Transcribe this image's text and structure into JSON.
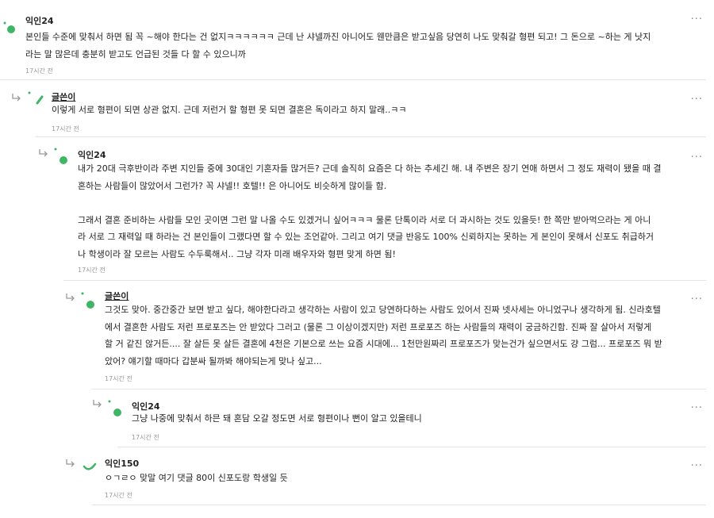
{
  "comments": [
    {
      "author": "익인24",
      "text": "본인들 수준에 맞춰서 하면 됨 꼭 ~해야 한다는 건 없지ㅋㅋㅋㅋㅋㅋ 근데 난 샤넬까진 아니어도 웬만큼은 받고싶음 당연히 나도 맞춰갈 형편 되고! 그 돈으로 ~하는 게 낫지\n라는 말 많은데 충분히 받고도 언급된 것들 다 할 수 있으니까",
      "time": "17시간 전"
    },
    {
      "author": "글쓴이",
      "text": "이렇게 서로 형편이 되면 상관 없지. 근데 저런거 할 형편 못 되면 결혼은 독이라고 하지 말래..ㅋㅋ",
      "time": "17시간 전"
    },
    {
      "author": "익인24",
      "text": "내가 20대 극후반이라 주변 지인들 중에 30대인 기혼자들 많거든? 근데 솔직히 요즘은 다 하는 추세긴 해. 내 주변은 장기 연애 하면서 그 정도 재력이 됐을 때 결\n혼하는 사람들이 많았어서 그런가? 꼭 샤넬!! 호텔!! 은 아니어도 비슷하게 많이들 함.\n\n그래서 결혼 준비하는 사람들 모인 곳이면 그런 말 나올 수도 있겠거니 싶어ㅋㅋㅋ 물론 단톡이라 서로 더 과시하는 것도 있을듯! 한 쪽만 받아먹으라는 게 아니\n라 서로 그 재력일 때 하라는 건 본인들이 그랬다면 할 수 있는 조언같아. 그리고 여기 댓글 반응도 100% 신뢰하지는 못하는 게 본인이 못해서 신포도 취급하거\n나 학생이라 잘 모르는 사람도 수두룩해서.. 그냥 각자 미래 배우자와 형편 맞게 하면 됨!",
      "time": "17시간 전"
    },
    {
      "author": "글쓴이",
      "text": "그것도 맞아. 중간중간 보면 받고 싶다, 해야한다라고 생각하는 사람이 있고 당연하다하는 사람도 있어서 진짜 넷사세는 아니었구나 생각하게 됨. 신라호텔\n에서 결혼한 사람도 저런 프로포즈는 안 받았다 그러고 (물론 그 이상이겠지만) 저런 프로포즈 하는 사람들의 재력이 궁금하긴함. 진짜 잘 살아서 저렇게\n할 거 같진 않거든.... 잘 살든 못 살든 결혼에 4천은 기본으로 쓰는 요즘 시대에... 1천만원짜리 프로포즈가 맞는건가 싶으면서도 걍 그럼... 프로포즈 뭐 받\n았어? 얘기할 때마다 갑분싸 될까봐 해야되는게 맞나 싶고...",
      "time": "17시간 전"
    },
    {
      "author": "익인24",
      "text": "그냥 나중에 맞춰서 하믄 돼 혼담 오갈 정도면 서로 형편이나 뻔이 알고 있을테니",
      "time": "17시간 전"
    },
    {
      "author": "익인150",
      "text": "ㅇㄱㄹㅇ 맞말 여기 댓글 80이 신포도랑 학생일 듯",
      "time": "17시간 전"
    }
  ],
  "more_label": "...",
  "colors": {
    "accent_green": "#3fb566",
    "divider": "#e6e6e6"
  },
  "icons": {
    "avatar": "leaf-avatar-icon",
    "reply": "reply-arrow-icon",
    "more": "more-options-icon"
  }
}
